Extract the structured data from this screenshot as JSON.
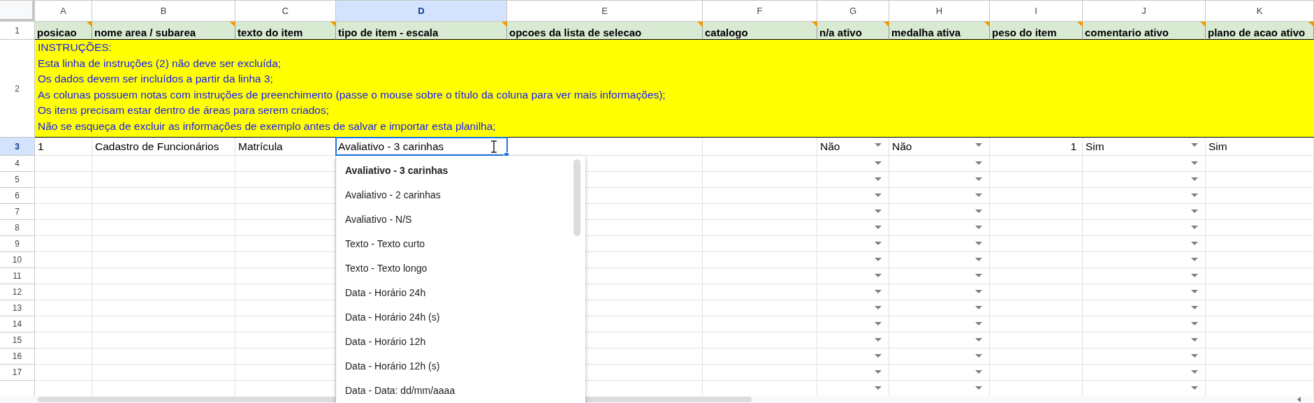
{
  "columns": [
    {
      "letter": "A",
      "header": "posicao",
      "selected": false,
      "note": true
    },
    {
      "letter": "B",
      "header": "nome area / subarea",
      "selected": false,
      "note": true
    },
    {
      "letter": "C",
      "header": "texto do item",
      "selected": false,
      "note": true
    },
    {
      "letter": "D",
      "header": "tipo de item - escala",
      "selected": true,
      "note": true
    },
    {
      "letter": "E",
      "header": "opcoes da lista de selecao",
      "selected": false,
      "note": true
    },
    {
      "letter": "F",
      "header": "catalogo",
      "selected": false,
      "note": true
    },
    {
      "letter": "G",
      "header": "n/a ativo",
      "selected": false,
      "note": true,
      "dropdown": true
    },
    {
      "letter": "H",
      "header": "medalha ativa",
      "selected": false,
      "note": true,
      "dropdown": true
    },
    {
      "letter": "I",
      "header": "peso do item",
      "selected": false,
      "note": true
    },
    {
      "letter": "J",
      "header": "comentario ativo",
      "selected": false,
      "note": true,
      "dropdown": true
    },
    {
      "letter": "K",
      "header": "plano de acao ativo",
      "selected": false,
      "note": true
    }
  ],
  "row_headers": [
    {
      "label": "1",
      "selected": false
    },
    {
      "label": "2",
      "selected": false
    },
    {
      "label": "3",
      "selected": true
    },
    {
      "label": "4",
      "selected": false
    },
    {
      "label": "5",
      "selected": false
    },
    {
      "label": "6",
      "selected": false
    },
    {
      "label": "7",
      "selected": false
    },
    {
      "label": "8",
      "selected": false
    },
    {
      "label": "9",
      "selected": false
    },
    {
      "label": "10",
      "selected": false
    },
    {
      "label": "11",
      "selected": false
    },
    {
      "label": "12",
      "selected": false
    },
    {
      "label": "13",
      "selected": false
    },
    {
      "label": "14",
      "selected": false
    },
    {
      "label": "15",
      "selected": false
    },
    {
      "label": "16",
      "selected": false
    },
    {
      "label": "17",
      "selected": false
    }
  ],
  "instructions": [
    "INSTRUÇÕES:",
    "Esta linha de instruções (2) não deve ser excluída;",
    "Os dados devem ser incluídos a partir da linha 3;",
    "As colunas possuem notas com instruções de preenchimento (passe o mouse sobre o título da coluna para ver mais informações);",
    "Os itens precisam estar dentro de áreas para serem criados;",
    "Não se esqueça de excluir as informações de exemplo antes de salvar e importar esta planilha;"
  ],
  "data_row": [
    {
      "value": "1",
      "kind": "text"
    },
    {
      "value": "Cadastro de Funcionários",
      "kind": "text"
    },
    {
      "value": "Matrícula",
      "kind": "text"
    },
    {
      "value": "Avaliativo - 3 carinhas",
      "kind": "editing"
    },
    {
      "kind": "empty"
    },
    {
      "kind": "empty"
    },
    {
      "value": "Não",
      "kind": "text"
    },
    {
      "value": "Não",
      "kind": "text"
    },
    {
      "value": "1",
      "kind": "number"
    },
    {
      "value": "Sim",
      "kind": "text"
    },
    {
      "value": "Sim",
      "kind": "text"
    }
  ],
  "dropdown_list": [
    {
      "label": "Avaliativo - 3 carinhas",
      "selected": true
    },
    {
      "label": "Avaliativo - 2 carinhas",
      "selected": false
    },
    {
      "label": "Avaliativo - N/S",
      "selected": false
    },
    {
      "label": "Texto - Texto curto",
      "selected": false
    },
    {
      "label": "Texto - Texto longo",
      "selected": false
    },
    {
      "label": "Data - Horário 24h",
      "selected": false
    },
    {
      "label": "Data - Horário 24h (s)",
      "selected": false
    },
    {
      "label": "Data - Horário 12h",
      "selected": false
    },
    {
      "label": "Data - Horário 12h (s)",
      "selected": false
    },
    {
      "label": "Data - Data: dd/mm/aaaa",
      "selected": false
    }
  ]
}
